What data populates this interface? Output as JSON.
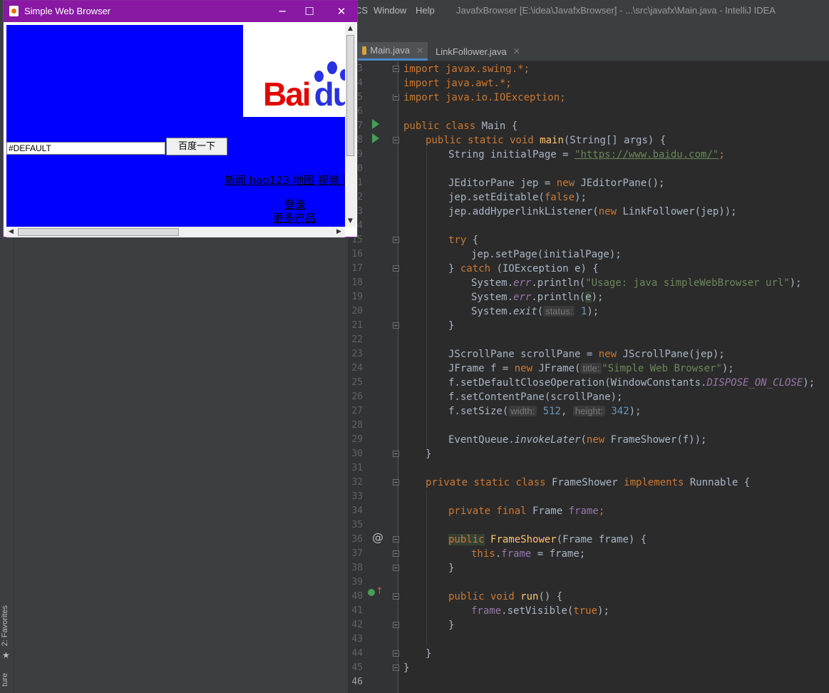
{
  "ide": {
    "menu": [
      "CS",
      "Window",
      "Help"
    ],
    "project_title": "JavafxBrowser [E:\\idea\\JavafxBrowser] - ...\\src\\javafx\\Main.java - IntelliJ IDEA",
    "side_tabs": [
      "2: Favorites",
      "ture"
    ],
    "tabs": [
      {
        "label": "Main.java",
        "active": true,
        "icon_color": "#d8a33a"
      },
      {
        "label": "LinkFollower.java",
        "active": false,
        "icon_color": "#3592c4"
      }
    ],
    "colors": {
      "keyword": "#cc7832",
      "string": "#6a8759",
      "number": "#6897bb",
      "function": "#ffc66d",
      "field": "#9876aa",
      "text": "#a9b7c6"
    },
    "lines": [
      3,
      4,
      5,
      6,
      7,
      8,
      9,
      10,
      11,
      12,
      13,
      14,
      15,
      16,
      17,
      18,
      19,
      20,
      21,
      22,
      23,
      24,
      25,
      26,
      27,
      28,
      29,
      30,
      31,
      32,
      33,
      34,
      35,
      36,
      37,
      38,
      39,
      40,
      41,
      42,
      43,
      44,
      45,
      46
    ],
    "current_line": 46,
    "code": {
      "import_swing": "import javax.swing.*;",
      "import_awt": "import java.awt.*;",
      "import_io": "import java.io.IOException;",
      "class_decl_kw": "public class",
      "class_decl_name": " Main {",
      "main_kw": "public static void",
      "main_name": "main",
      "main_rest": "(String[] args) {",
      "initial_page_decl": "String initialPage = ",
      "initial_page_url": "\"https://www.baidu.com/\"",
      "jep_decl": "JEditorPane jep = ",
      "new_kw": "new",
      "jep_ctor": " JEditorPane();",
      "set_editable": "jep.setEditable(",
      "false_kw": "false",
      "close_paren_semi": ");",
      "add_listener": "jep.addHyperlinkListener(",
      "link_follower": " LinkFollower(jep));",
      "try_kw": "try",
      "open_brace": " {",
      "set_page": "jep.setPage(initialPage);",
      "catch_close": "} ",
      "catch_kw": "catch",
      "catch_rest": " (IOException e) {",
      "system": "System.",
      "err": "err",
      "println_open": ".println(",
      "usage_str": "\"Usage: java simpleWebBrowser url\"",
      "println_e": "e",
      "exit": "exit",
      "status_hint": "status:",
      "one": "1",
      "close_brace": "}",
      "scroll_decl": "JScrollPane scrollPane = ",
      "scroll_ctor": " JScrollPane(jep);",
      "frame_decl": "JFrame f = ",
      "frame_ctor": " JFrame(",
      "title_hint": "title:",
      "title_str": "\"Simple Web Browser\"",
      "set_default": "f.setDefaultCloseOperation(WindowConstants.",
      "dispose": "DISPOSE_ON_CLOSE",
      "set_content": "f.setContentPane(scrollPane);",
      "set_size": "f.setSize(",
      "width_hint": "width:",
      "width_val": "512",
      "height_hint": "height:",
      "height_val": "342",
      "event_queue": "EventQueue.",
      "invoke_later": "invokeLater",
      "frame_shower_new": " FrameShower(f));",
      "private_static_class": "private static class",
      "frame_shower_name": " FrameShower ",
      "implements_kw": "implements",
      "runnable": " Runnable {",
      "private_final": "private final",
      "frame_field_type": " Frame ",
      "frame_field": "frame",
      "semi": ";",
      "public_kw": "public",
      "frame_shower_ctor": "FrameShower",
      "ctor_params": "(Frame frame) {",
      "this_kw": "this",
      "assign_frame": " = frame;",
      "public_void": "public void",
      "run": "run",
      "run_rest": "() {",
      "set_visible": ".setVisible(",
      "true_kw": "true",
      "dot": ".",
      "comma": ", ",
      "open_paren": "("
    }
  },
  "swing": {
    "title": "Simple Web Browser",
    "minimize": "─",
    "maximize": "☐",
    "close": "✕",
    "logo_text": "Bai",
    "logo_suffix": "du",
    "search_value": "#DEFAULT",
    "search_button": "百度一下",
    "nav_links": "新闻 hao123 地图 视频 贴",
    "login": "登录",
    "more_products": "更多产品",
    "page_bg": "#0000ff"
  }
}
